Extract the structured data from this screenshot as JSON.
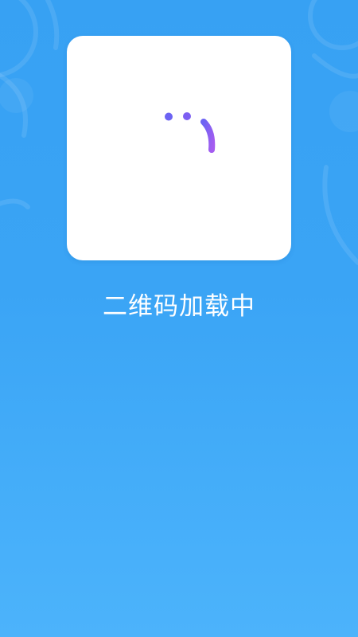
{
  "loading": {
    "status_text": "二维码加载中",
    "icon": "loading-spinner-icon"
  },
  "colors": {
    "background_top": "#37a1f3",
    "background_bottom": "#4cb3fb",
    "card": "#ffffff",
    "spinner_start": "#6c63f3",
    "spinner_end": "#a55cf0",
    "text": "#ffffff"
  }
}
